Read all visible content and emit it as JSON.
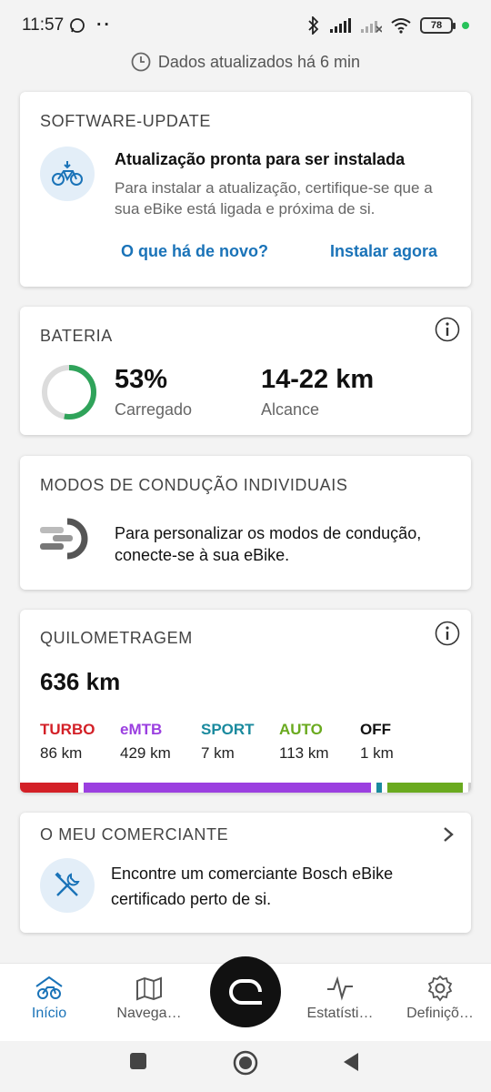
{
  "status": {
    "time": "11:57",
    "battery": "78"
  },
  "updated_text": "Dados atualizados há 6 min",
  "software": {
    "title": "SOFTWARE-UPDATE",
    "headline": "Atualização pronta para ser instalada",
    "desc": "Para instalar a atualização, certifique-se que a sua eBike está ligada e próxima de si.",
    "whats_new": "O que há de novo?",
    "install_now": "Instalar agora"
  },
  "battery": {
    "title": "BATERIA",
    "percent": "53%",
    "percent_value": 53,
    "charged_label": "Carregado",
    "range": "14-22 km",
    "range_label": "Alcance"
  },
  "modes": {
    "title": "MODOS DE CONDUÇÃO INDIVIDUAIS",
    "text": "Para personalizar os modos de condução, conecte-se à sua eBike."
  },
  "odometer": {
    "title": "QUILOMETRAGEM",
    "total": "636 km",
    "modes": [
      {
        "name": "TURBO",
        "km": "86 km",
        "value": 86,
        "color": "#d32027"
      },
      {
        "name": "eMTB",
        "km": "429 km",
        "value": 429,
        "color": "#9b3fe0"
      },
      {
        "name": "SPORT",
        "km": "7 km",
        "value": 7,
        "color": "#1a8a9e"
      },
      {
        "name": "AUTO",
        "km": "113 km",
        "value": 113,
        "color": "#6aaa1f"
      },
      {
        "name": "OFF",
        "km": "1 km",
        "value": 1,
        "color": "#111111"
      }
    ]
  },
  "dealer": {
    "title": "O MEU COMERCIANTE",
    "text": "Encontre um comerciante Bosch eBike certificado perto de si."
  },
  "nav": {
    "home": "Início",
    "navigation": "Navega…",
    "stats": "Estatísti…",
    "settings": "Definiçõ…"
  },
  "colors": {
    "accent": "#1a73b8",
    "battery_green": "#2fa35a",
    "icon_bg": "#e3eef8"
  }
}
